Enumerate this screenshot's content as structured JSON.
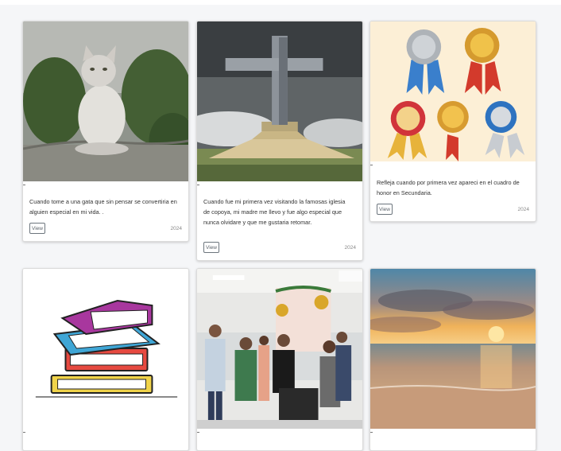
{
  "cards": [
    {
      "description": "Cuando tome a una gata que sin pensar se convertiria en alguien especial en mi vida. .",
      "button_label": "View",
      "year": "2024",
      "image": "gray-cat-photo"
    },
    {
      "description": "Cuando fue mi primera vez visitando la famosas iglesia de copoya, mi madre me llevo y fue algo especial que nunca olvidare y que me gustaria retomar.",
      "button_label": "View",
      "year": "2024",
      "image": "cross-monument-photo"
    },
    {
      "description": "Refleja cuando por primera vez apareci en el cuadro de honor en Secundaria.",
      "button_label": "View",
      "year": "2024",
      "image": "award-ribbons-illustration"
    },
    {
      "image": "stacked-books-illustration"
    },
    {
      "image": "office-group-celebration-photo"
    },
    {
      "image": "beach-sunset-photo"
    }
  ]
}
